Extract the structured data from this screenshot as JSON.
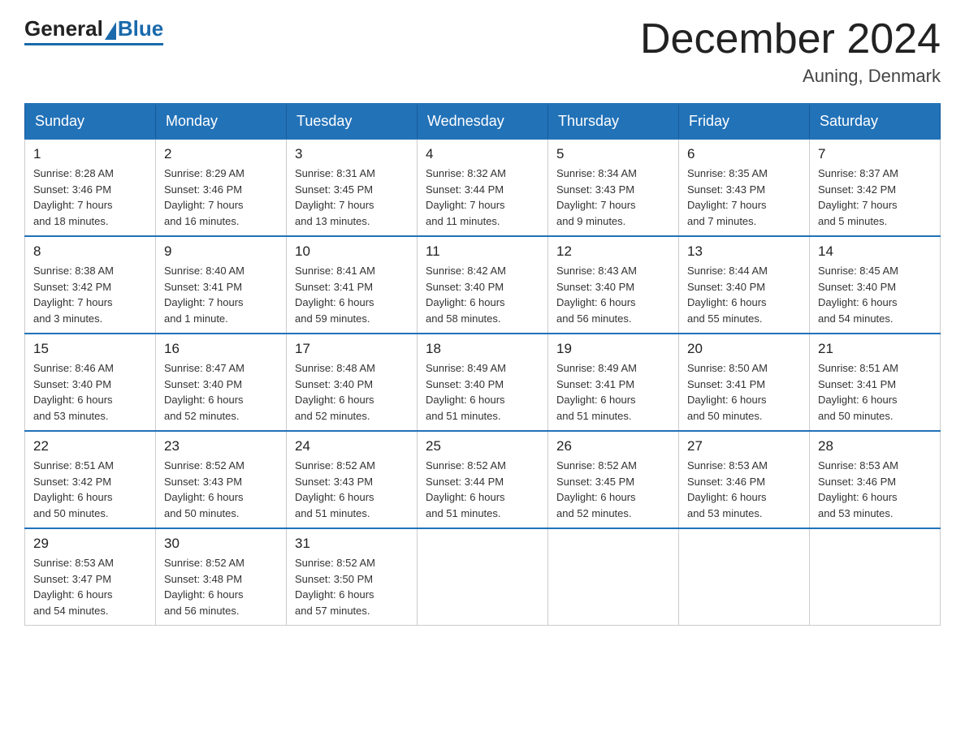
{
  "logo": {
    "general": "General",
    "blue": "Blue"
  },
  "header": {
    "month_title": "December 2024",
    "location": "Auning, Denmark"
  },
  "weekdays": [
    "Sunday",
    "Monday",
    "Tuesday",
    "Wednesday",
    "Thursday",
    "Friday",
    "Saturday"
  ],
  "weeks": [
    [
      {
        "day": "1",
        "sunrise": "8:28 AM",
        "sunset": "3:46 PM",
        "daylight": "7 hours and 18 minutes."
      },
      {
        "day": "2",
        "sunrise": "8:29 AM",
        "sunset": "3:46 PM",
        "daylight": "7 hours and 16 minutes."
      },
      {
        "day": "3",
        "sunrise": "8:31 AM",
        "sunset": "3:45 PM",
        "daylight": "7 hours and 13 minutes."
      },
      {
        "day": "4",
        "sunrise": "8:32 AM",
        "sunset": "3:44 PM",
        "daylight": "7 hours and 11 minutes."
      },
      {
        "day": "5",
        "sunrise": "8:34 AM",
        "sunset": "3:43 PM",
        "daylight": "7 hours and 9 minutes."
      },
      {
        "day": "6",
        "sunrise": "8:35 AM",
        "sunset": "3:43 PM",
        "daylight": "7 hours and 7 minutes."
      },
      {
        "day": "7",
        "sunrise": "8:37 AM",
        "sunset": "3:42 PM",
        "daylight": "7 hours and 5 minutes."
      }
    ],
    [
      {
        "day": "8",
        "sunrise": "8:38 AM",
        "sunset": "3:42 PM",
        "daylight": "7 hours and 3 minutes."
      },
      {
        "day": "9",
        "sunrise": "8:40 AM",
        "sunset": "3:41 PM",
        "daylight": "7 hours and 1 minute."
      },
      {
        "day": "10",
        "sunrise": "8:41 AM",
        "sunset": "3:41 PM",
        "daylight": "6 hours and 59 minutes."
      },
      {
        "day": "11",
        "sunrise": "8:42 AM",
        "sunset": "3:40 PM",
        "daylight": "6 hours and 58 minutes."
      },
      {
        "day": "12",
        "sunrise": "8:43 AM",
        "sunset": "3:40 PM",
        "daylight": "6 hours and 56 minutes."
      },
      {
        "day": "13",
        "sunrise": "8:44 AM",
        "sunset": "3:40 PM",
        "daylight": "6 hours and 55 minutes."
      },
      {
        "day": "14",
        "sunrise": "8:45 AM",
        "sunset": "3:40 PM",
        "daylight": "6 hours and 54 minutes."
      }
    ],
    [
      {
        "day": "15",
        "sunrise": "8:46 AM",
        "sunset": "3:40 PM",
        "daylight": "6 hours and 53 minutes."
      },
      {
        "day": "16",
        "sunrise": "8:47 AM",
        "sunset": "3:40 PM",
        "daylight": "6 hours and 52 minutes."
      },
      {
        "day": "17",
        "sunrise": "8:48 AM",
        "sunset": "3:40 PM",
        "daylight": "6 hours and 52 minutes."
      },
      {
        "day": "18",
        "sunrise": "8:49 AM",
        "sunset": "3:40 PM",
        "daylight": "6 hours and 51 minutes."
      },
      {
        "day": "19",
        "sunrise": "8:49 AM",
        "sunset": "3:41 PM",
        "daylight": "6 hours and 51 minutes."
      },
      {
        "day": "20",
        "sunrise": "8:50 AM",
        "sunset": "3:41 PM",
        "daylight": "6 hours and 50 minutes."
      },
      {
        "day": "21",
        "sunrise": "8:51 AM",
        "sunset": "3:41 PM",
        "daylight": "6 hours and 50 minutes."
      }
    ],
    [
      {
        "day": "22",
        "sunrise": "8:51 AM",
        "sunset": "3:42 PM",
        "daylight": "6 hours and 50 minutes."
      },
      {
        "day": "23",
        "sunrise": "8:52 AM",
        "sunset": "3:43 PM",
        "daylight": "6 hours and 50 minutes."
      },
      {
        "day": "24",
        "sunrise": "8:52 AM",
        "sunset": "3:43 PM",
        "daylight": "6 hours and 51 minutes."
      },
      {
        "day": "25",
        "sunrise": "8:52 AM",
        "sunset": "3:44 PM",
        "daylight": "6 hours and 51 minutes."
      },
      {
        "day": "26",
        "sunrise": "8:52 AM",
        "sunset": "3:45 PM",
        "daylight": "6 hours and 52 minutes."
      },
      {
        "day": "27",
        "sunrise": "8:53 AM",
        "sunset": "3:46 PM",
        "daylight": "6 hours and 53 minutes."
      },
      {
        "day": "28",
        "sunrise": "8:53 AM",
        "sunset": "3:46 PM",
        "daylight": "6 hours and 53 minutes."
      }
    ],
    [
      {
        "day": "29",
        "sunrise": "8:53 AM",
        "sunset": "3:47 PM",
        "daylight": "6 hours and 54 minutes."
      },
      {
        "day": "30",
        "sunrise": "8:52 AM",
        "sunset": "3:48 PM",
        "daylight": "6 hours and 56 minutes."
      },
      {
        "day": "31",
        "sunrise": "8:52 AM",
        "sunset": "3:50 PM",
        "daylight": "6 hours and 57 minutes."
      },
      null,
      null,
      null,
      null
    ]
  ],
  "labels": {
    "sunrise": "Sunrise:",
    "sunset": "Sunset:",
    "daylight": "Daylight:"
  }
}
